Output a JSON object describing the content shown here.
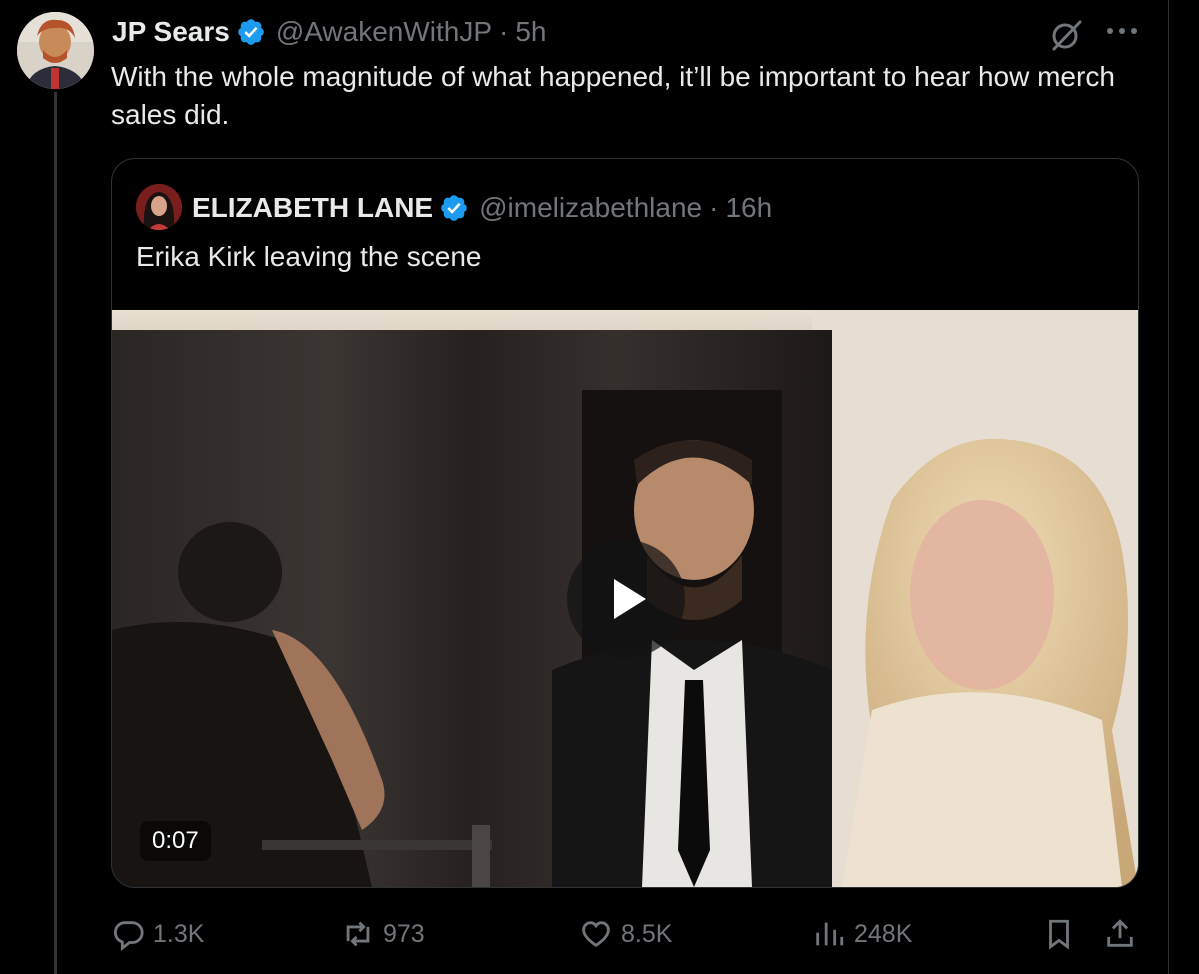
{
  "tweet": {
    "author_name": "JP Sears",
    "handle": "@AwakenWithJP",
    "separator": "·",
    "time": "5h",
    "text": "With the whole magnitude of what happened, it’ll be important to hear how merch sales did."
  },
  "quoted_tweet": {
    "author_name": "ELIZABETH LANE",
    "handle": "@imelizabethlane",
    "separator": "·",
    "time": "16h",
    "text": "Erika Kirk leaving the scene",
    "video": {
      "duration": "0:07"
    }
  },
  "actions": {
    "replies": "1.3K",
    "reposts": "973",
    "likes": "8.5K",
    "views": "248K"
  },
  "icons": {
    "verified": "verified-badge-icon",
    "grok": "grok-icon",
    "more": "more-dots-icon",
    "reply": "reply-icon",
    "repost": "repost-icon",
    "like": "heart-icon",
    "views": "views-chart-icon",
    "bookmark": "bookmark-icon",
    "share": "share-icon",
    "play": "play-icon"
  },
  "colors": {
    "background": "#000000",
    "text": "#e7e9ea",
    "secondary": "#71767b",
    "verified": "#1d9bf0",
    "border": "#2f3336"
  }
}
